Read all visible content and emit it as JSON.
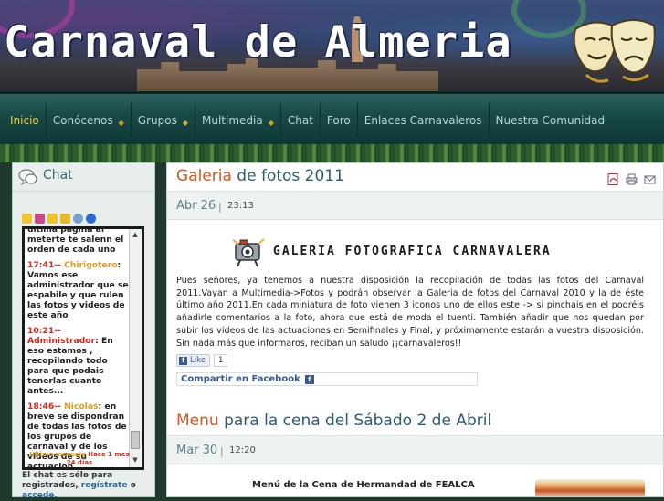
{
  "header": {
    "site_title": "Carnaval de Almeria"
  },
  "nav": {
    "items": [
      {
        "label": "Inicio",
        "active": true,
        "has_submenu": false
      },
      {
        "label": "Conócenos",
        "active": false,
        "has_submenu": true
      },
      {
        "label": "Grupos",
        "active": false,
        "has_submenu": true
      },
      {
        "label": "Multimedia",
        "active": false,
        "has_submenu": true
      },
      {
        "label": "Chat",
        "active": false,
        "has_submenu": false
      },
      {
        "label": "Foro",
        "active": false,
        "has_submenu": false
      },
      {
        "label": "Enlaces Carnavaleros",
        "active": false,
        "has_submenu": false
      },
      {
        "label": "Nuestra Comunidad",
        "active": false,
        "has_submenu": false
      }
    ]
  },
  "sidebar": {
    "title": "Chat",
    "messages": [
      {
        "time": "",
        "name": "",
        "text": "última página al meterte te salenn el orden de cada uno"
      },
      {
        "time": "17:41--",
        "name": "Chirigotero",
        "text": "Vamos ese administrador que se espabile y que rulen las fotos y videos de este año"
      },
      {
        "time": "10:21--",
        "name": "Administrador",
        "text": "En eso estamos , recopilando todo para que podais tenerlas cuanto antes..."
      },
      {
        "time": "18:46--",
        "name": "Nicolas",
        "text": "en breve se dispondran de todas las fotos de los grupos de carnaval y de los videos de su actuacion."
      }
    ],
    "last_message_label": "Último mensaje",
    "last_message_ago": "Hace 1 mes 24 días",
    "note_prefix": "El chat es sólo para registrados,",
    "note_link1": "regístrate",
    "note_or": "o",
    "note_link2": "accede."
  },
  "posts": [
    {
      "title_highlight": "Galeria",
      "title_rest": " de fotos 2011",
      "date": "Abr 26",
      "separator": "|",
      "time": "23:13",
      "banner_text": "GALERIA FOTOGRAFICA CARNAVALERA",
      "body": "Pues señores, ya tenemos a nuestra disposición la recopilación de todas las fotos del Carnaval 2011.Vayan a Multimedia->Fotos y podrán observar la Galeria de fotos del Carnaval 2010 y la de éste último año 2011.En cada miniatura de foto vienen 3 iconos uno de ellos este -> si pinchais en el podréis añadirle comentarios a la foto, ahora que está de moda el tuenti. También añadir que nos quedan por subir los videos de las actuaciones en Semifinales y Final, y próximamente estarán a vuestra disposición. Sin nada más que informaros, reciban un saludo ¡¡carnavaleros!!",
      "like_label": "Like",
      "like_count": "1",
      "share_label": "Compartir en Facebook"
    },
    {
      "title_highlight": "Menu",
      "title_rest": " para la cena del Sábado 2 de Abril",
      "date": "Mar 30",
      "separator": "|",
      "time": "12:20",
      "content_heading": "Menú de la Cena de Hermandad de FEALCA"
    }
  ],
  "icons": {
    "pdf": "pdf-icon",
    "print": "print-icon",
    "email": "email-icon",
    "chat": "chat-bubbles-icon",
    "facebook": "facebook-icon"
  },
  "colors": {
    "accent_orange": "#d2561d",
    "nav_active": "#f2cc33",
    "title_teal": "#2c5c6c",
    "chat_time_red": "#d42a1a",
    "chat_name_orange": "#e09a1d",
    "facebook_blue": "#3b5998"
  }
}
